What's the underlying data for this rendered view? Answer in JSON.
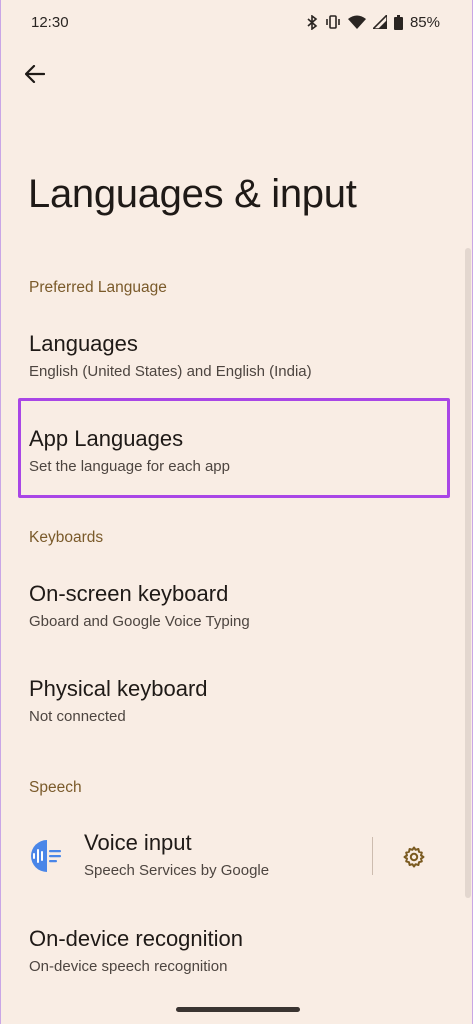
{
  "status_bar": {
    "time": "12:30",
    "battery_percent": "85%",
    "icons": [
      "bluetooth-icon",
      "vibrate-icon",
      "wifi-icon",
      "cell-signal-icon",
      "battery-icon"
    ]
  },
  "header": {
    "back_icon": "arrow-back-icon",
    "title": "Languages & input"
  },
  "sections": {
    "preferred_language": {
      "header": "Preferred Language",
      "items": [
        {
          "title": "Languages",
          "subtitle": "English (United States) and English (India)"
        },
        {
          "title": "App Languages",
          "subtitle": "Set the language for each app"
        }
      ]
    },
    "keyboards": {
      "header": "Keyboards",
      "items": [
        {
          "title": "On-screen keyboard",
          "subtitle": "Gboard and Google Voice Typing"
        },
        {
          "title": "Physical keyboard",
          "subtitle": "Not connected"
        }
      ]
    },
    "speech": {
      "header": "Speech",
      "items": [
        {
          "title": "Voice input",
          "subtitle": "Speech Services by Google",
          "icon": "voice-input-icon",
          "action_icon": "gear-icon"
        },
        {
          "title": "On-device recognition",
          "subtitle": "On-device speech recognition"
        }
      ]
    }
  },
  "colors": {
    "background": "#f9ede4",
    "section_header": "#7a5a2a",
    "highlight_border": "#a946e6",
    "gear_icon": "#7a5a20"
  }
}
